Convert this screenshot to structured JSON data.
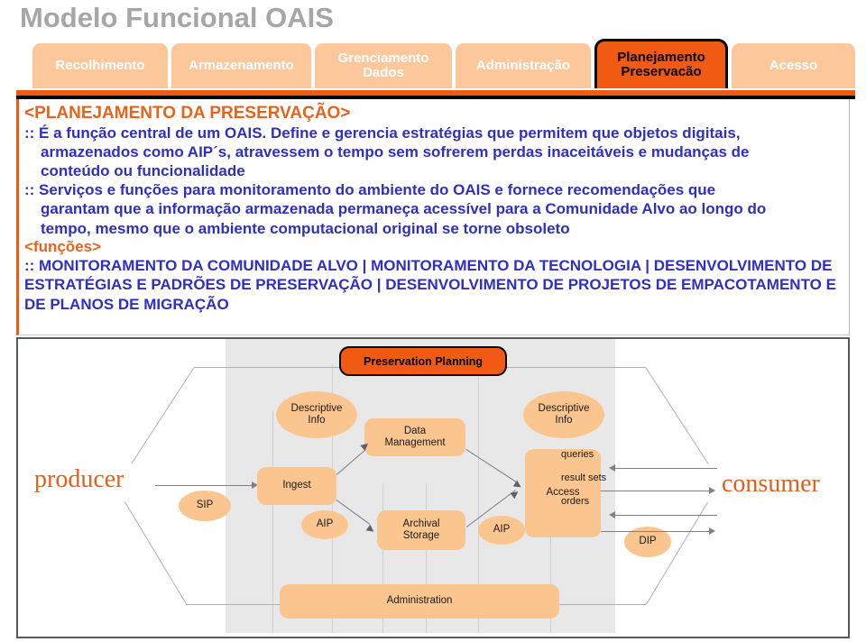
{
  "slide": {
    "title": "Modelo Funcional OAIS"
  },
  "tabs": [
    {
      "label": "Recolhimento",
      "active": false
    },
    {
      "label": "Armazenamento",
      "active": false
    },
    {
      "label": "Grenciamento Dados",
      "line1": "Grenciamento",
      "line2": "Dados",
      "active": false
    },
    {
      "label": "Administração",
      "active": false
    },
    {
      "label": "Planejamento Preservacão",
      "line1": "Planejamento",
      "line2": "Preservacão",
      "active": true
    },
    {
      "label": "Acesso",
      "active": false
    }
  ],
  "content": {
    "heading": "<PLANEJAMENTO DA  PRESERVAÇÃO>",
    "bullet1_line1": ":: É a função central de um OAIS. Define e gerencia estratégias que permitem que objetos digitais,",
    "bullet1_line2": "armazenados como AIP´s, atravessem o tempo sem sofrerem perdas inaceitáveis e mudanças de",
    "bullet1_line3": "conteúdo ou funcionalidade",
    "bullet2_line1": ":: Serviços e funções para monitoramento do ambiente do OAIS  e fornece recomendações que",
    "bullet2_line2": "garantam que a informação armazenada permaneça acessível para a Comunidade Alvo ao longo do",
    "bullet2_line3": "tempo, mesmo que o ambiente computacional original se torne obsoleto",
    "subheading": "<funções>",
    "bullet3_line1": ":: MONITORAMENTO DA COMUNIDADE ALVO | MONITORAMENTO DA TECNOLOGIA |",
    "bullet3_line2": "DESENVOLVIMENTO DE ESTRATÉGIAS E PADRÕES DE PRESERVAÇÃO |",
    "bullet3_line3": "DESENVOLVIMENTO DE PROJETOS DE EMPACOTAMENTO E DE PLANOS DE MIGRAÇÃO"
  },
  "diagram": {
    "preservation_planning": "Preservation Planning",
    "producer": "producer",
    "consumer": "consumer",
    "sip": "SIP",
    "aip_left": "AIP",
    "aip_right": "AIP",
    "dip": "DIP",
    "descriptive_info_left_l1": "Descriptive",
    "descriptive_info_left_l2": "Info",
    "descriptive_info_right_l1": "Descriptive",
    "descriptive_info_right_l2": "Info",
    "ingest": "Ingest",
    "data_management_l1": "Data",
    "data_management_l2": "Management",
    "archival_storage_l1": "Archival",
    "archival_storage_l2": "Storage",
    "access": "Access",
    "administration": "Administration",
    "queries": "queries",
    "result_sets": "result  sets",
    "orders": "orders"
  },
  "colors": {
    "title_gray": "#a6a6a6",
    "tab_peach": "#fcc79a",
    "tab_active_orange": "#f05a13",
    "heading_orange": "#e8631a",
    "body_blue": "#2f2fc0",
    "node_peach": "#fbc58f",
    "actor_orange": "#e2601a",
    "panel_gray": "#e8e8e8"
  }
}
